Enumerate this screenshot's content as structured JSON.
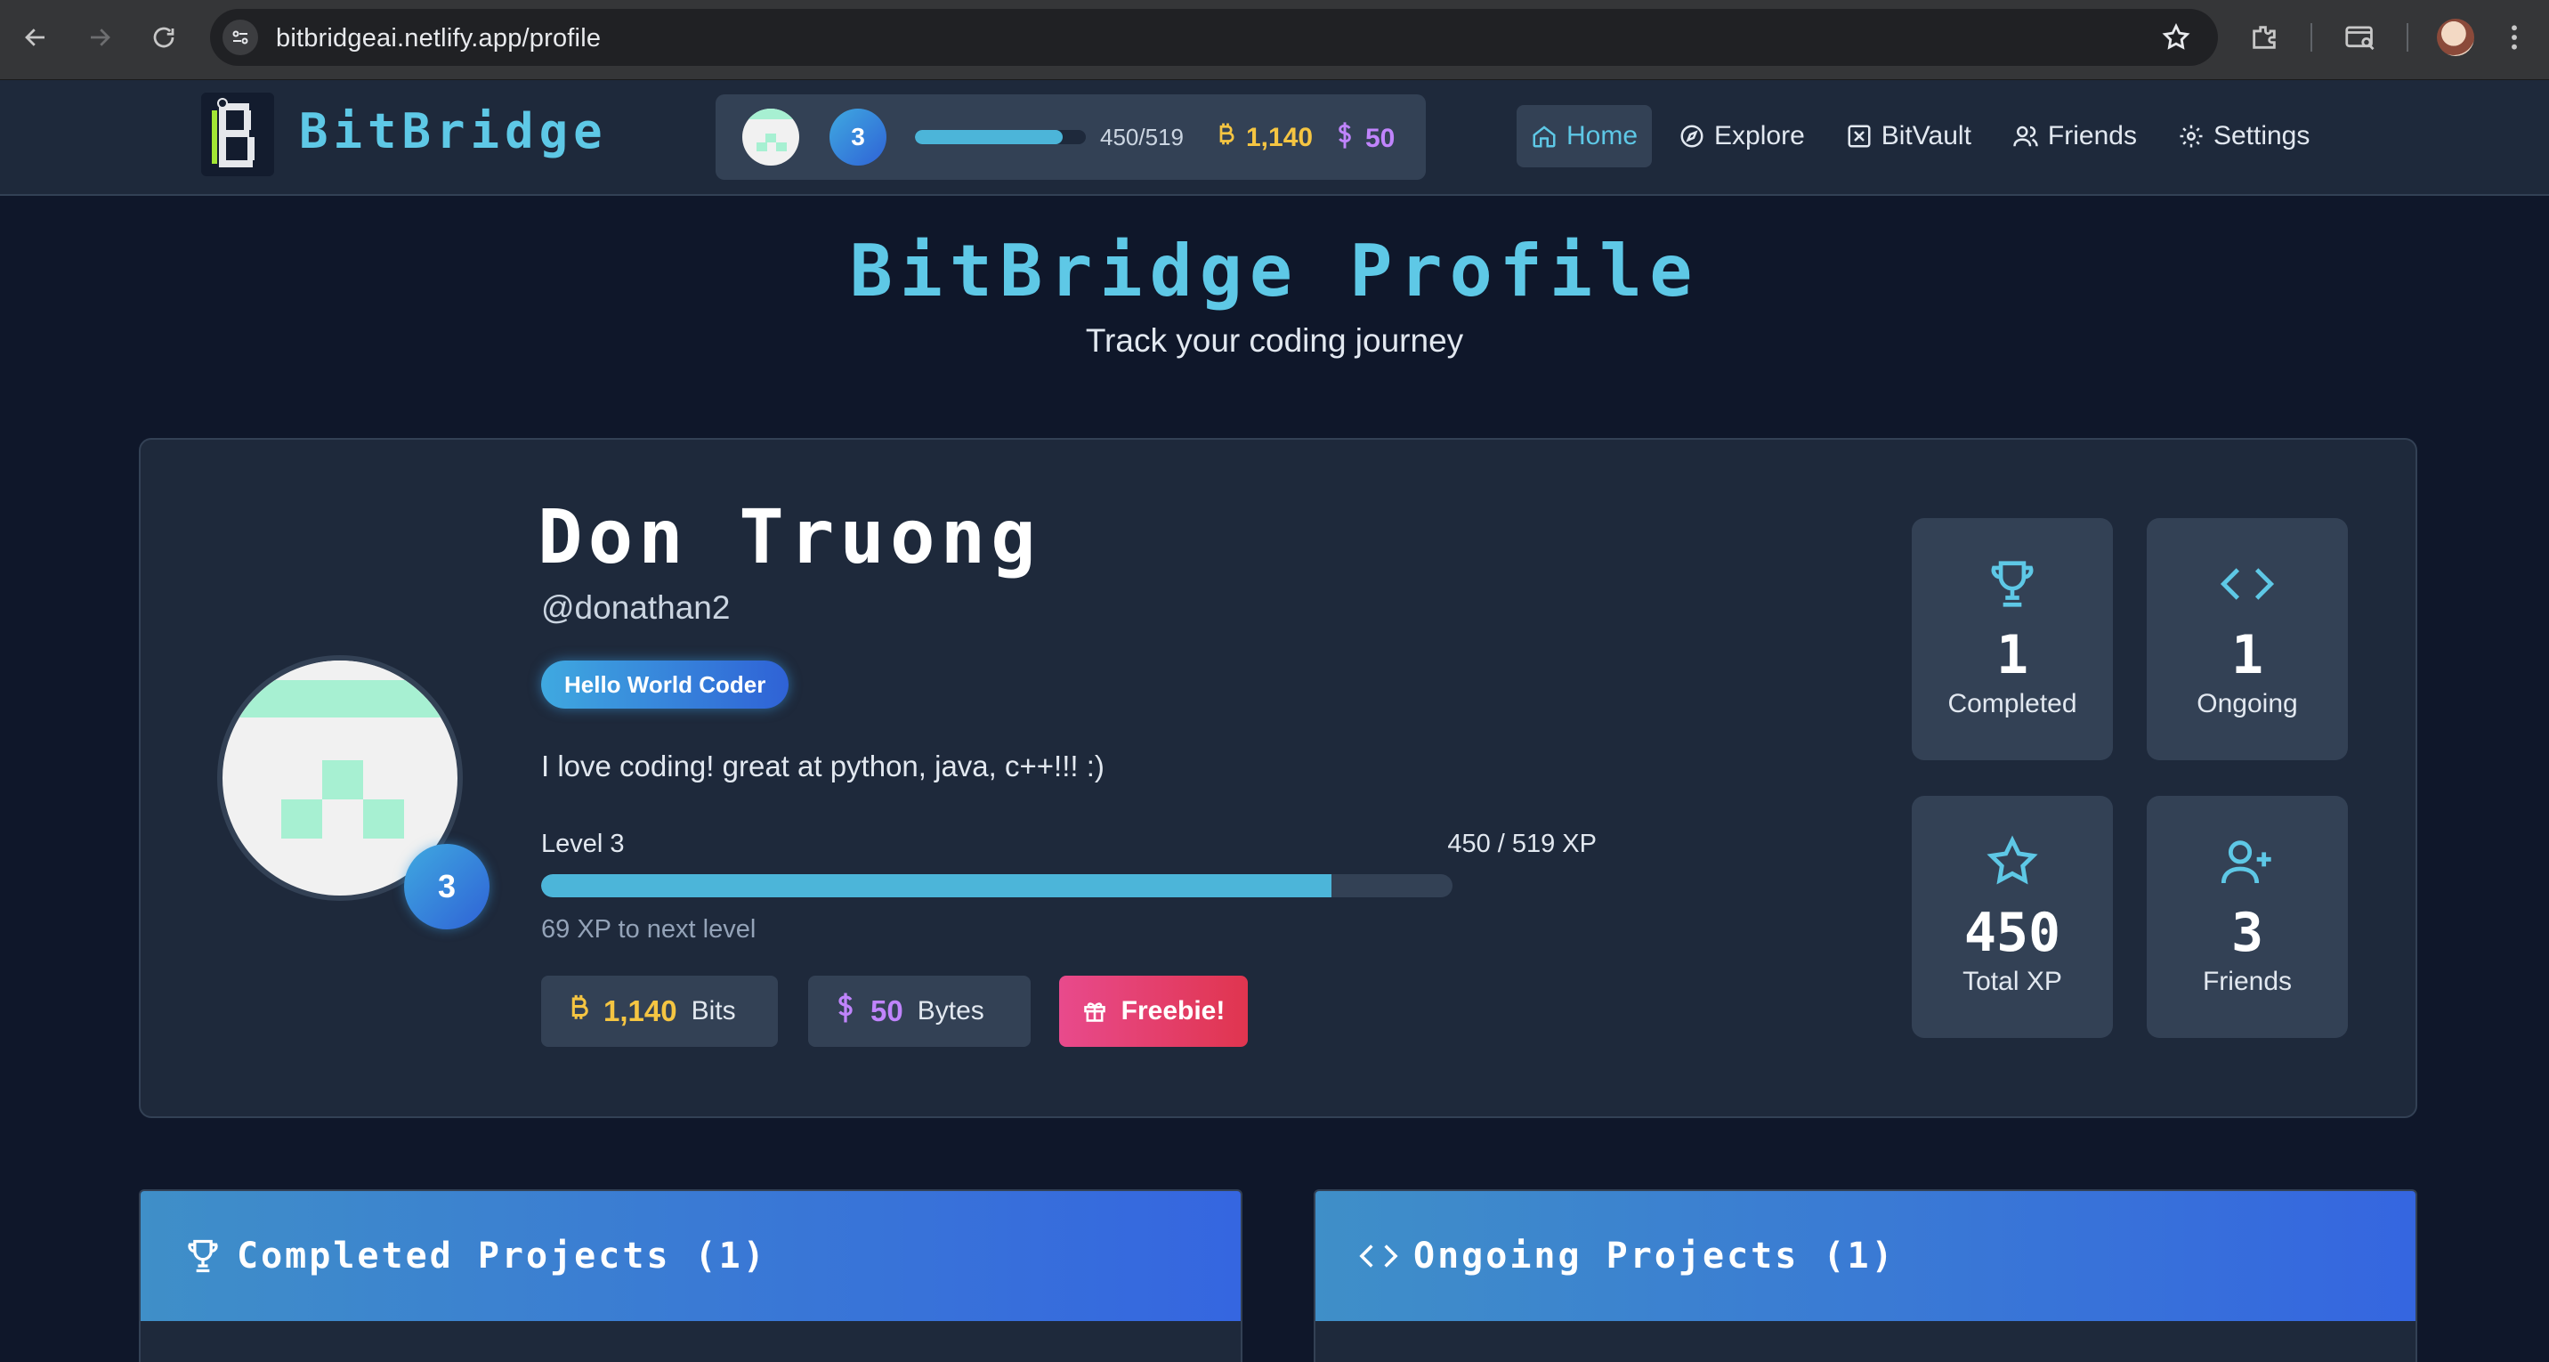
{
  "browser": {
    "url": "bitbridgeai.netlify.app/profile"
  },
  "nav": {
    "brand": "BitBridge",
    "level": "3",
    "xp_text": "450/519",
    "xp_progress": 0.867,
    "bits": "1,140",
    "bytes": "50",
    "links": [
      {
        "label": "Home",
        "icon": "home-icon",
        "active": true
      },
      {
        "label": "Explore",
        "icon": "compass-icon",
        "active": false
      },
      {
        "label": "BitVault",
        "icon": "vault-icon",
        "active": false
      },
      {
        "label": "Friends",
        "icon": "users-icon",
        "active": false
      },
      {
        "label": "Settings",
        "icon": "gear-icon",
        "active": false
      }
    ]
  },
  "header": {
    "title": "BitBridge Profile",
    "subtitle": "Track your coding journey"
  },
  "profile": {
    "name": "Don Truong",
    "handle": "@donathan2",
    "badge": "Hello World Coder",
    "bio": "I love coding! great at python, java, c++!!! :)",
    "level_label": "Level 3",
    "level_number": "3",
    "xp_label": "450 / 519 XP",
    "xp_progress": 0.867,
    "xp_next": "69 XP to next level",
    "bits_value": "1,140",
    "bits_unit": "Bits",
    "bytes_value": "50",
    "bytes_unit": "Bytes",
    "freebie_label": "Freebie!"
  },
  "stats": [
    {
      "value": "1",
      "label": "Completed",
      "icon": "trophy-icon"
    },
    {
      "value": "1",
      "label": "Ongoing",
      "icon": "code-icon"
    },
    {
      "value": "450",
      "label": "Total XP",
      "icon": "star-icon"
    },
    {
      "value": "3",
      "label": "Friends",
      "icon": "user-plus-icon"
    }
  ],
  "sections": {
    "completed": "Completed Projects (1)",
    "ongoing": "Ongoing Projects (1)"
  },
  "colors": {
    "accent": "#5ec8e6",
    "bits": "#f5c542",
    "bytes": "#c084fc",
    "freebie": "#e84a8c",
    "background": "#0f172a",
    "card": "#1e293b"
  }
}
